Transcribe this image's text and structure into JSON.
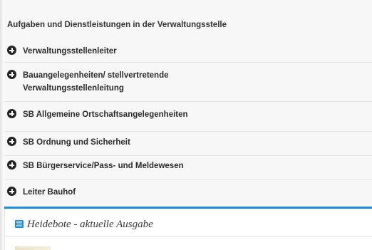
{
  "section": {
    "title": "Aufgaben und Dienstleistungen in der Verwaltungsstelle"
  },
  "accordion": {
    "items": [
      {
        "label": "Verwaltungsstellenleiter"
      },
      {
        "label": "Bauangelegenheiten/ stellvertretende Verwaltungsstellenleitung"
      },
      {
        "label": "SB Allgemeine Ortschaftsangelegenheiten"
      },
      {
        "label": "SB Ordnung und Sicherheit"
      },
      {
        "label": "SB Bürgerservice/Pass- und Meldewesen"
      },
      {
        "label": "Leiter Bauhof"
      }
    ],
    "expand_icon": "plus-circle-icon"
  },
  "news": {
    "icon": "newspaper-icon",
    "title": "Heidebote - aktuelle Ausgabe"
  },
  "colors": {
    "accent": "#1d8fd6",
    "panel_background": "#f7f7f7",
    "text": "#2b2b2b"
  }
}
